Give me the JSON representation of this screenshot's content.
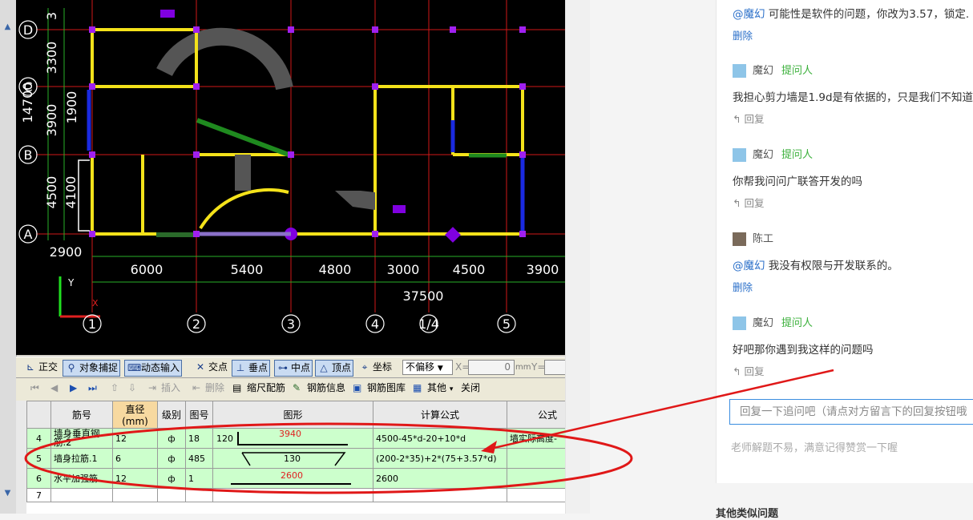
{
  "cad": {
    "row_labels": [
      "D",
      "C",
      "B",
      "A"
    ],
    "column_labels": [
      "1",
      "2",
      "3",
      "4",
      "1/4",
      "5"
    ],
    "left_dims": [
      "3300",
      "3900",
      "4500",
      "2900"
    ],
    "left_total": "14700",
    "inner_dims": [
      "1900",
      "4100"
    ],
    "bottom_dims": [
      "6000",
      "5400",
      "4800",
      "3000",
      "4500",
      "3900"
    ],
    "bottom_total": "37500",
    "axis_y": "Y",
    "axis_x": "X",
    "top_row_digit": "3"
  },
  "cad_toolbar": {
    "ortho": "正交",
    "snap": "对象捕捉",
    "dynamic": "动态输入",
    "intersection": "交点",
    "perpendicular": "垂点",
    "midpoint": "中点",
    "vertex": "顶点",
    "coordinate": "坐标",
    "offset_select": "不偏移",
    "x_label": "X=",
    "x_value": "0",
    "unit_mm": "mm",
    "y_label": "Y="
  },
  "rebar_toolbar": {
    "insert": "插入",
    "delete": "删除",
    "scale": "缩尺配筋",
    "info": "钢筋信息",
    "library": "钢筋图库",
    "other": "其他",
    "close": "关闭"
  },
  "rebar_table": {
    "headers": [
      "筋号",
      "直径(mm)",
      "级别",
      "图号",
      "图形",
      "计算公式",
      "公式"
    ],
    "rows": [
      {
        "no": "4",
        "name": "墙身垂直钢筋.2",
        "dia": "12",
        "grade": "ф",
        "fig": "18",
        "shape_left": "120",
        "shape_val": "3940",
        "formula": "4500-45*d-20+10*d",
        "desc": "墙实际高度-"
      },
      {
        "no": "5",
        "name": "墙身拉筋.1",
        "dia": "6",
        "grade": "ф",
        "fig": "485",
        "shape_val": "130",
        "formula": "(200-2*35)+2*(75+3.57*d)",
        "desc": ""
      },
      {
        "no": "6",
        "name": "水平加强筋",
        "dia": "12",
        "grade": "ф",
        "fig": "1",
        "shape_val": "2600",
        "formula": "2600",
        "desc": ""
      },
      {
        "no": "7",
        "name": "",
        "dia": "",
        "grade": "",
        "fig": "",
        "shape_val": "",
        "formula": "",
        "desc": ""
      }
    ]
  },
  "comments": {
    "first_text_mention": "@魔幻",
    "first_text": " 可能性是软件的问题，你改为3.57，锁定.",
    "first_action": "删除",
    "items": [
      {
        "user": "魔幻",
        "badge": "提问人",
        "text": "我担心剪力墙是1.9d是有依据的，只是我们不知道",
        "action": "回复"
      },
      {
        "user": "魔幻",
        "badge": "提问人",
        "text": "你帮我问问广联答开发的吗",
        "action": "回复"
      },
      {
        "user": "陈工",
        "badge": "",
        "mention": "@魔幻",
        "text": " 我没有权限与开发联系的。",
        "action": "删除"
      },
      {
        "user": "魔幻",
        "badge": "提问人",
        "text": "好吧那你遇到我这样的问题吗",
        "action": "回复"
      }
    ],
    "reply_placeholder": "回复一下追问吧（请点对方留言下的回复按钮哦",
    "tip": "老师解题不易，满意记得赞赏一下喔",
    "related": "其他类似问题"
  },
  "colors": {
    "accent_blue": "#2a6fc9",
    "asker_green": "#3bb03b",
    "annotation_red": "#e01818"
  }
}
